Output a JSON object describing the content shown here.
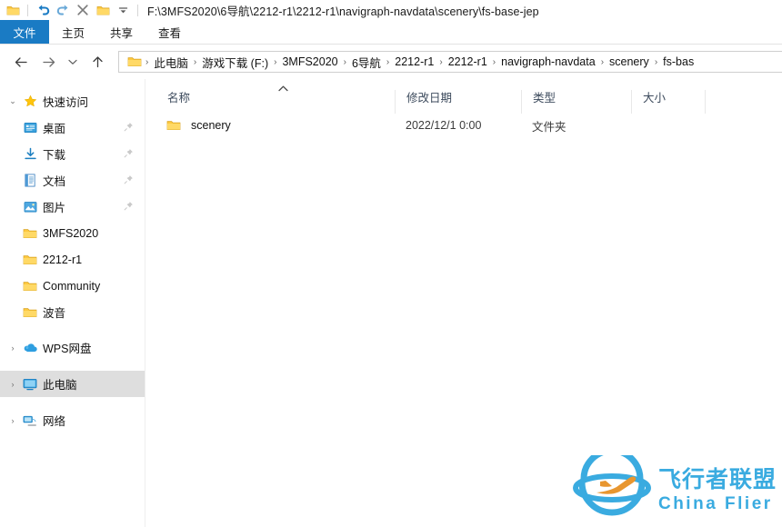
{
  "window": {
    "title": "F:\\3MFS2020\\6导航\\2212-r1\\2212-r1\\navigraph-navdata\\scenery\\fs-base-jep",
    "qat": [
      {
        "name": "folder-icon",
        "label": "文件资源管理器"
      },
      {
        "name": "undo-icon",
        "label": "撤销"
      },
      {
        "name": "redo-icon",
        "label": "重做"
      },
      {
        "name": "delete-icon",
        "label": "删除"
      },
      {
        "name": "new-folder-icon",
        "label": "新建文件夹"
      },
      {
        "name": "chevron-down-icon",
        "label": "自定义快速访问工具栏"
      }
    ]
  },
  "ribbon": {
    "tabs": [
      {
        "label": "文件",
        "active": true
      },
      {
        "label": "主页",
        "active": false
      },
      {
        "label": "共享",
        "active": false
      },
      {
        "label": "查看",
        "active": false
      }
    ]
  },
  "navbar": {
    "back": "←",
    "forward": "→",
    "history": "⌄",
    "up": "↑",
    "breadcrumb": [
      "此电脑",
      "游戏下载 (F:)",
      "3MFS2020",
      "6导航",
      "2212-r1",
      "2212-r1",
      "navigraph-navdata",
      "scenery",
      "fs-bas"
    ],
    "separator": "›"
  },
  "sidebar": {
    "groups": [
      {
        "name": "quick-access",
        "label": "快速访问",
        "icon": "star-icon",
        "expanded": true,
        "chevron": "⌄",
        "items": [
          {
            "label": "桌面",
            "icon": "desktop-icon",
            "pinned": true
          },
          {
            "label": "下载",
            "icon": "download-icon",
            "pinned": true
          },
          {
            "label": "文档",
            "icon": "document-icon",
            "pinned": true
          },
          {
            "label": "图片",
            "icon": "pictures-icon",
            "pinned": true
          },
          {
            "label": "3MFS2020",
            "icon": "folder-icon",
            "pinned": false
          },
          {
            "label": "2212-r1",
            "icon": "folder-icon",
            "pinned": false
          },
          {
            "label": "Community",
            "icon": "folder-icon",
            "pinned": false
          },
          {
            "label": "波音",
            "icon": "folder-icon",
            "pinned": false
          }
        ]
      },
      {
        "name": "wps-cloud",
        "label": "WPS网盘",
        "icon": "cloud-icon",
        "expanded": false,
        "chevron": "›",
        "items": []
      },
      {
        "name": "this-pc",
        "label": "此电脑",
        "icon": "monitor-icon",
        "expanded": false,
        "selected": true,
        "chevron": "›",
        "items": []
      },
      {
        "name": "network",
        "label": "网络",
        "icon": "network-icon",
        "expanded": false,
        "chevron": "›",
        "items": []
      }
    ]
  },
  "filelist": {
    "columns": [
      {
        "label": "名称",
        "sorted": "asc",
        "sort_glyph": "⌃"
      },
      {
        "label": "修改日期"
      },
      {
        "label": "类型"
      },
      {
        "label": "大小"
      }
    ],
    "rows": [
      {
        "icon": "folder-icon",
        "name": "scenery",
        "modified": "2022/12/1 0:00",
        "type": "文件夹",
        "size": ""
      }
    ]
  },
  "watermark": {
    "cn": "飞行者联盟",
    "en": "China Flier",
    "logo": "airplane-globe-logo",
    "color": "#3aabe0",
    "accent": "#e8962f"
  },
  "colors": {
    "accent_blue": "#1a7bc4",
    "folder_yellow": "#fdc73c",
    "selection_gray": "#dedede"
  }
}
